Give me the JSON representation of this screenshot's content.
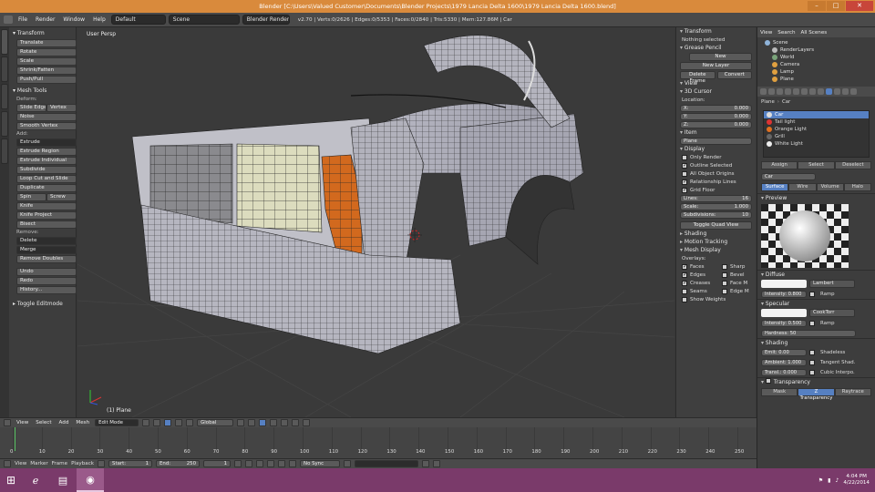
{
  "window": {
    "title": "Blender [C:\\Users\\Valued Customer\\Documents\\Blender Projects\\1979 Lancia Delta 1600\\1979 Lancia Delta 1600.blend]",
    "buttons": [
      "–",
      "□",
      "✕"
    ]
  },
  "infobar": {
    "menus": [
      "File",
      "Render",
      "Window",
      "Help"
    ],
    "layout": "Default",
    "scene": "Scene",
    "engine": "Blender Render",
    "stats": "v2.70 | Verts:0/2626 | Edges:0/5353 | Faces:0/2840 | Tris:5330 | Mem:127.86M | Car"
  },
  "toolshelf": {
    "transform_header": "Transform",
    "transform": [
      "Translate",
      "Rotate",
      "Scale",
      "Shrink/Fatten",
      "Push/Pull"
    ],
    "mesh_tools_header": "Mesh Tools",
    "deform_label": "Deform:",
    "deform": [
      "Slide Edge",
      "Vertex",
      "Noise",
      "Smooth Vertex"
    ],
    "add_label": "Add:",
    "add": [
      "Extrude",
      "Extrude Region",
      "Extrude Individual",
      "Subdivide",
      "Loop Cut and Slide",
      "Duplicate"
    ],
    "spin": "Spin",
    "screw": "Screw",
    "add_more": [
      "Knife",
      "Knife Project",
      "Bisect"
    ],
    "remove_label": "Remove:",
    "remove": [
      "Delete",
      "Merge",
      "Remove Doubles"
    ],
    "history": [
      "Undo",
      "Redo",
      "History..."
    ],
    "toggle_editmode": "Toggle Editmode"
  },
  "viewport": {
    "view_label": "User Persp",
    "object_label": "(1) Plane"
  },
  "npanel": {
    "transform": "Transform",
    "median_label": "Nothing selected",
    "grease_pencil": "Grease Pencil",
    "gp_new": "New",
    "gp_new_layer": "New Layer",
    "gp_delete": "Delete Frame",
    "gp_convert": "Convert",
    "view": "View",
    "cursor": "3D Cursor",
    "location": "Location:",
    "cursor_x": "0.000",
    "cursor_y": "0.000",
    "cursor_z": "0.000",
    "item": "Item",
    "item_name": "Plane",
    "display": "Display",
    "only_render": "Only Render",
    "outline_selected": "Outline Selected",
    "all_object_origins": "All Object Origins",
    "relationship_lines": "Relationship Lines",
    "grid_floor": "Grid Floor",
    "lines_label": "Lines:",
    "lines": "16",
    "scale_label": "Scale:",
    "scale": "1.000",
    "subdiv_label": "Subdivisions:",
    "subdiv": "10",
    "toggle_quad": "Toggle Quad View",
    "shading": "Shading",
    "motion_tracking": "Motion Tracking",
    "mesh_display": "Mesh Display",
    "overlays": "Overlays:",
    "faces": "Faces",
    "sharp": "Sharp",
    "edges": "Edges",
    "bevel": "Bevel",
    "creases": "Creases",
    "face_m": "Face M",
    "seams": "Seams",
    "edge_m": "Edge M",
    "show_weights": "Show Weights"
  },
  "outliner": {
    "tabs": [
      "View",
      "Search",
      "All Scenes"
    ],
    "items": [
      "Scene",
      "RenderLayers",
      "World",
      "Camera",
      "Lamp",
      "Plane"
    ]
  },
  "properties": {
    "object_label": "Plane",
    "material_label": "Car",
    "materials": [
      "Car",
      "Tail light",
      "Orange Light",
      "Grill",
      "White Light"
    ],
    "slot_name": "Car",
    "ptabs": [
      "Assign",
      "Select",
      "Deselect"
    ],
    "mtabs": [
      "Surface",
      "Wire",
      "Volume",
      "Halo"
    ],
    "preview": "Preview",
    "diffuse": "Diffuse",
    "diffuse_shader": "Lambert",
    "diffuse_intensity": "Intensity: 0.800",
    "ramp": "Ramp",
    "specular": "Specular",
    "spec_shader": "CookTorr",
    "spec_intensity": "Intensity: 0.500",
    "hardness": "Hardness: 50",
    "shading": "Shading",
    "emit": "Emit: 0.00",
    "shadeless": "Shadeless",
    "ambient": "Ambient: 1.000",
    "tangent": "Tangent Shad.",
    "translucency": "Transl.: 0.000",
    "cubic": "Cubic Interpo.",
    "transparency": "Transparency",
    "bottom_tabs": [
      "Mask",
      "Z Transparency",
      "Raytrace"
    ]
  },
  "vpheader": {
    "menus": [
      "View",
      "Select",
      "Add",
      "Mesh"
    ],
    "mode": "Edit Mode",
    "pivot": "Global"
  },
  "timeline": {
    "ticks": [
      0,
      10,
      20,
      30,
      40,
      50,
      60,
      70,
      80,
      90,
      100,
      110,
      120,
      130,
      140,
      150,
      160,
      170,
      180,
      190,
      200,
      210,
      220,
      230,
      240,
      250
    ],
    "menus": [
      "View",
      "Marker",
      "Frame",
      "Playback"
    ],
    "start": "Start:",
    "start_val": "1",
    "end": "End:",
    "end_val": "250",
    "current": "1",
    "sync": "No Sync"
  },
  "taskbar": {
    "time": "4:04 PM",
    "date": "4/22/2014"
  }
}
